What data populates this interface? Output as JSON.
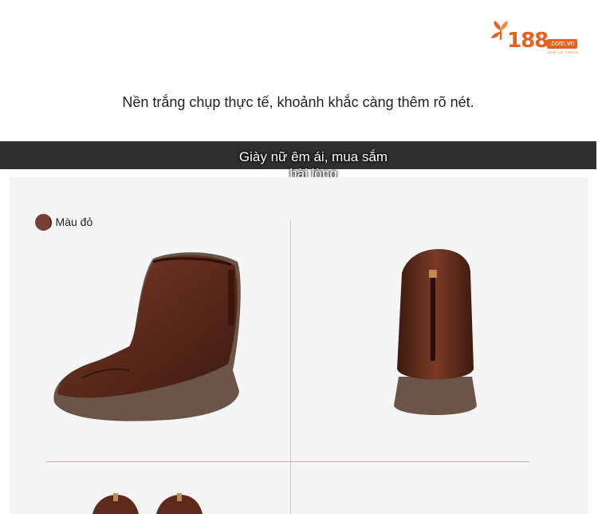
{
  "logo": {
    "number": "188",
    "domain": ".com.vn",
    "tagline": "XEM LÀ THÍCH"
  },
  "caption": "Nền trắng chụp thực tế, khoảnh khắc càng thêm rõ nét.",
  "banner": "Giày nữ êm ái, mua sắm hài lòng",
  "swatch": {
    "label": ") Màu đỏ",
    "color": "#7a3d36"
  },
  "colors": {
    "brand": "#e8601c",
    "banner_bg": "#2f2f2f",
    "panel_bg": "#f5f5f5",
    "leather": "#5e2a1d"
  }
}
